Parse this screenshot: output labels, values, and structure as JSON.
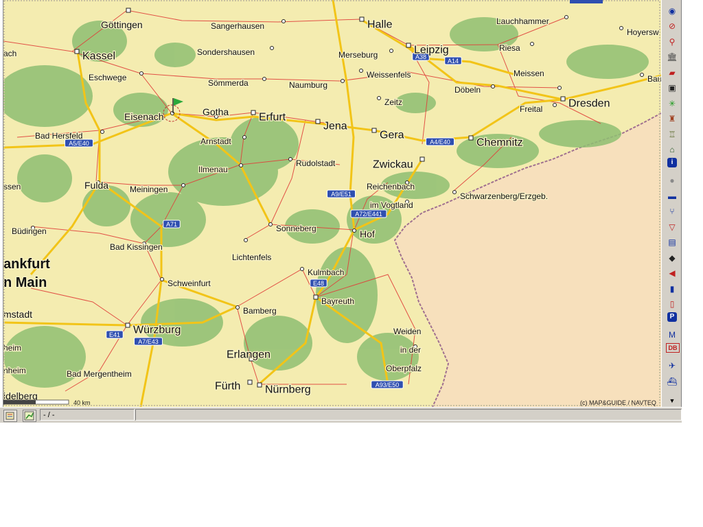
{
  "map": {
    "cities": [
      {
        "name": "Göttingen",
        "size": "medium"
      },
      {
        "name": "Sangerhausen",
        "size": "small"
      },
      {
        "name": "Halle",
        "size": "large"
      },
      {
        "name": "Lauchhammer",
        "size": "small"
      },
      {
        "name": "Hoyersw",
        "size": "small"
      },
      {
        "name": "ach",
        "size": "small"
      },
      {
        "name": "Kassel",
        "size": "large"
      },
      {
        "name": "Sondershausen",
        "size": "small"
      },
      {
        "name": "Merseburg",
        "size": "small"
      },
      {
        "name": "Leipzig",
        "size": "large"
      },
      {
        "name": "Riesa",
        "size": "small"
      },
      {
        "name": "Eschwege",
        "size": "small"
      },
      {
        "name": "Sömmerda",
        "size": "small"
      },
      {
        "name": "Naumburg",
        "size": "small"
      },
      {
        "name": "Weissenfels",
        "size": "small"
      },
      {
        "name": "Meissen",
        "size": "small"
      },
      {
        "name": "Bau",
        "size": "small"
      },
      {
        "name": "Döbeln",
        "size": "small"
      },
      {
        "name": "Zeitz",
        "size": "small"
      },
      {
        "name": "Dresden",
        "size": "large"
      },
      {
        "name": "Eisenach",
        "size": "medium"
      },
      {
        "name": "Gotha",
        "size": "medium"
      },
      {
        "name": "Erfurt",
        "size": "large"
      },
      {
        "name": "Freital",
        "size": "small"
      },
      {
        "name": "Jena",
        "size": "large"
      },
      {
        "name": "Bad Hersfeld",
        "size": "small"
      },
      {
        "name": "Gera",
        "size": "large"
      },
      {
        "name": "Arnstadt",
        "size": "small"
      },
      {
        "name": "Chemnitz",
        "size": "large"
      },
      {
        "name": "Rudolstadt",
        "size": "small"
      },
      {
        "name": "Ilmenau",
        "size": "small"
      },
      {
        "name": "Zwickau",
        "size": "large"
      },
      {
        "name": "ssen",
        "size": "small"
      },
      {
        "name": "Fulda",
        "size": "medium"
      },
      {
        "name": "Meiningen",
        "size": "small"
      },
      {
        "name": "Reichenbach",
        "size": "small"
      },
      {
        "name": "Schwarzenberg/Erzgeb.",
        "size": "small"
      },
      {
        "name": "im Vogtland",
        "size": "small"
      },
      {
        "name": "Büdingen",
        "size": "small"
      },
      {
        "name": "Sonneberg",
        "size": "small"
      },
      {
        "name": "Hof",
        "size": "medium"
      },
      {
        "name": "Bad Kissingen",
        "size": "small"
      },
      {
        "name": "ankfurt",
        "size": "xlarge"
      },
      {
        "name": "Lichtenfels",
        "size": "small"
      },
      {
        "name": "n Main",
        "size": "xlarge"
      },
      {
        "name": "Kulmbach",
        "size": "small"
      },
      {
        "name": "Schweinfurt",
        "size": "small"
      },
      {
        "name": "Bayreuth",
        "size": "small"
      },
      {
        "name": "Bamberg",
        "size": "small"
      },
      {
        "name": "mstadt",
        "size": "medium"
      },
      {
        "name": "Würzburg",
        "size": "large"
      },
      {
        "name": "Weiden",
        "size": "small"
      },
      {
        "name": "heim",
        "size": "small"
      },
      {
        "name": "in der",
        "size": "small"
      },
      {
        "name": "Erlangen",
        "size": "large"
      },
      {
        "name": "Oberpfalz",
        "size": "small"
      },
      {
        "name": "nheim",
        "size": "small"
      },
      {
        "name": "Bad Mergentheim",
        "size": "small"
      },
      {
        "name": "Fürth",
        "size": "large"
      },
      {
        "name": "Nürnberg",
        "size": "large"
      },
      {
        "name": "idelberg",
        "size": "medium"
      }
    ],
    "road_labels": [
      "A38",
      "A14",
      "A5/E40",
      "A4/E40",
      "A9/E51",
      "A71",
      "A72/E441",
      "E48",
      "E41",
      "A7/E43",
      "A93/E50"
    ],
    "scale_label": "40 km",
    "copyright": "(c) MAP&GUIDE / NAVTEQ",
    "colors": {
      "land": "#f4ecb0",
      "forest": "#8fbf72",
      "highway": "#f2c418",
      "road": "#e0403a",
      "border": "#a07090",
      "czech": "#f7e0bc",
      "shield": "#2f4fb0"
    }
  },
  "toolbar": {
    "icons": [
      "eye-icon",
      "eye-crossed-icon",
      "pin-icon",
      "museum-icon",
      "car-icon",
      "camera-icon",
      "star-burst-icon",
      "castle-icon",
      "fortress-icon",
      "house-tree-icon",
      "info-icon",
      "ball-icon",
      "bed-icon",
      "fork-knife-icon",
      "cocktail-icon",
      "map-book-icon",
      "cube-icon",
      "sign-icon",
      "gas-pump-icon",
      "fuel-icon",
      "parking-icon",
      "metro-icon",
      "db-rail-icon",
      "airplane-icon",
      "ship-icon"
    ],
    "scroll_down": "▼"
  },
  "statusbar": {
    "coords": "- / -"
  }
}
